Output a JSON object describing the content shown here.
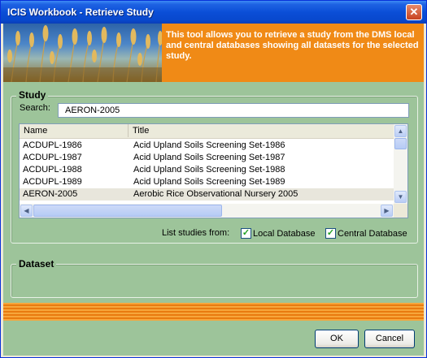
{
  "window": {
    "title": "ICIS Workbook - Retrieve Study"
  },
  "banner": {
    "text": "This tool allows you to retrieve a study from the DMS local and central databases showing all datasets for the selected study."
  },
  "study": {
    "group_label": "Study",
    "search_label": "Search:",
    "search_value": "AERON-2005",
    "columns": [
      "Name",
      "Title"
    ],
    "rows": [
      {
        "name": "ACDUPL-1986",
        "title": "Acid Upland Soils Screening Set-1986"
      },
      {
        "name": "ACDUPL-1987",
        "title": "Acid Upland Soils Screening Set-1987"
      },
      {
        "name": "ACDUPL-1988",
        "title": "Acid Upland Soils Screening Set-1988"
      },
      {
        "name": "ACDUPL-1989",
        "title": "Acid Upland Soils Screening Set-1989"
      },
      {
        "name": "AERON-2005",
        "title": "Aerobic Rice Observational Nursery 2005"
      }
    ],
    "selected_row": 4,
    "list_from_label": "List studies from:",
    "local_db_label": "Local Database",
    "local_db_checked": true,
    "central_db_label": "Central Database",
    "central_db_checked": true
  },
  "dataset": {
    "group_label": "Dataset"
  },
  "buttons": {
    "ok": "OK",
    "cancel": "Cancel"
  },
  "icons": {
    "close": "close-icon",
    "scroll_up": "arrow-up-icon",
    "scroll_down": "arrow-down-icon",
    "scroll_left": "arrow-left-icon",
    "scroll_right": "arrow-right-icon",
    "check": "check-icon"
  },
  "colors": {
    "titlebar": "#0a4ed7",
    "client_bg": "#9dc49a",
    "banner": "#f08a16"
  }
}
